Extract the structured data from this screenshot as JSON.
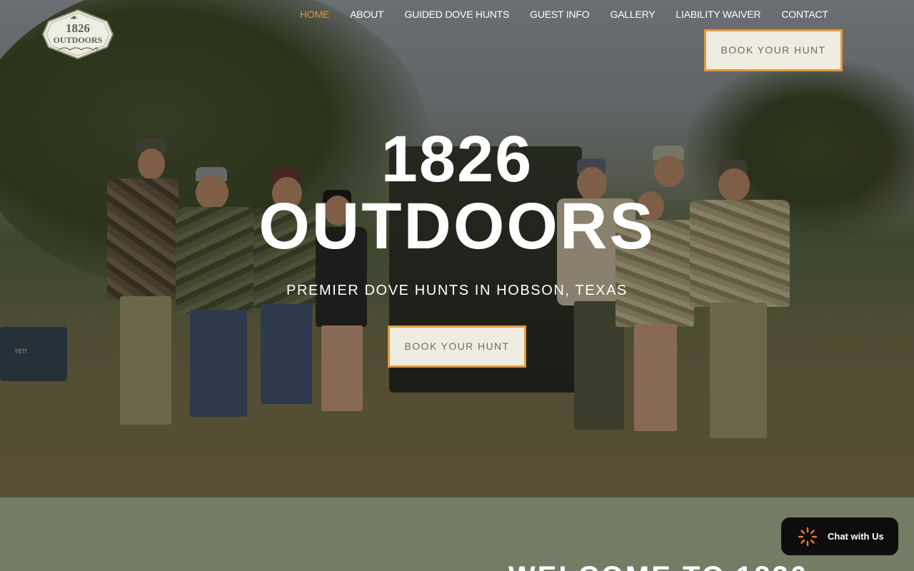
{
  "logo": {
    "text_top": "1826",
    "text_bottom": "OUTDOORS"
  },
  "nav": {
    "items": [
      {
        "label": "HOME",
        "active": true
      },
      {
        "label": "ABOUT"
      },
      {
        "label": "GUIDED DOVE HUNTS"
      },
      {
        "label": "GUEST INFO"
      },
      {
        "label": "GALLERY"
      },
      {
        "label": "LIABILITY WAIVER"
      },
      {
        "label": "CONTACT"
      }
    ],
    "cta_label": "BOOK YOUR HUNT"
  },
  "hero": {
    "title_line1": "1826",
    "title_line2": "OUTDOORS",
    "subtitle": "PREMIER DOVE HUNTS IN HOBSON, TEXAS",
    "cta_label": "BOOK YOUR HUNT",
    "cooler_text": "YETI"
  },
  "section": {
    "heading_partial": "WELCOME TO 1826"
  },
  "chat": {
    "label": "Chat with Us"
  },
  "colors": {
    "accent": "#e29a3d",
    "nav_active": "#e5903a",
    "button_bg": "#efede2",
    "button_text": "#6b6d5d",
    "section_bg": "#747c66",
    "chat_bg": "#0d0d0d"
  }
}
